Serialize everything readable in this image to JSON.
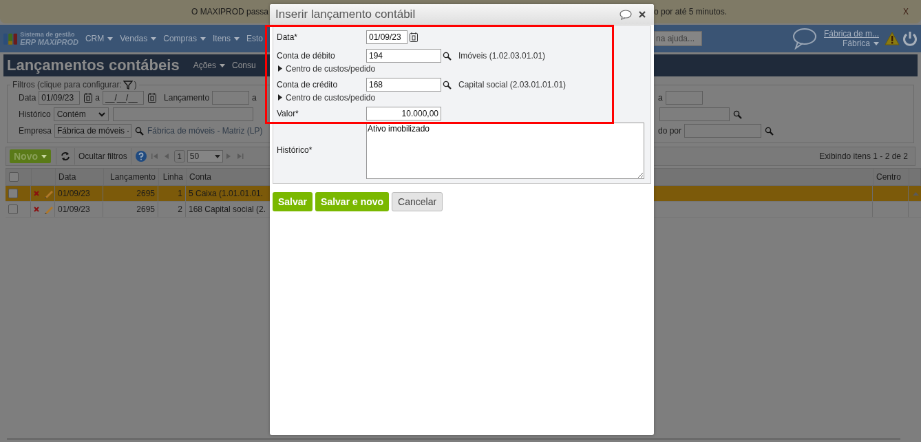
{
  "banner": {
    "text_left": "O MAXIPROD passa",
    "text_right": "o por até 5 minutos.",
    "close": "X"
  },
  "nav": {
    "brand_line1": "Sistema de gestão",
    "brand_line2": "ERP MAXIPROD",
    "menus": [
      {
        "label": "CRM",
        "dropdown": true
      },
      {
        "label": "Vendas",
        "dropdown": true
      },
      {
        "label": "Compras",
        "dropdown": true
      },
      {
        "label": "Itens",
        "dropdown": true
      },
      {
        "label": "Esto",
        "dropdown": false
      }
    ],
    "search": {
      "placeholder": "na ajuda..."
    },
    "company_link": "Fábrica de m...",
    "profile": "Fábrica"
  },
  "page_title": "Lançamentos contábeis",
  "page_menus": [
    {
      "label": "Ações",
      "dropdown": true
    },
    {
      "label": "Consu",
      "dropdown": false
    }
  ],
  "filters": {
    "legend": "Filtros (clique para configurar:",
    "legend_end": ")",
    "date": {
      "label": "Data",
      "from": "01/09/23",
      "sep": "a",
      "to": "__/__/__"
    },
    "entry": {
      "label": "Lançamento",
      "sep": "a"
    },
    "history": {
      "label": "Histórico",
      "mode": "Contém"
    },
    "company": {
      "label": "Empresa",
      "value": "Fábrica de móveis -",
      "description": "Fábrica de móveis - Matriz (LP)"
    },
    "right_sep": "a",
    "right_label": "do por"
  },
  "toolbar": {
    "new_button": "Novo",
    "hide_filters": "Ocultar filtros",
    "page": "1",
    "page_size": "50",
    "summary": "Exibindo itens 1 - 2 de 2"
  },
  "table": {
    "select_all": {
      "checked": false
    },
    "columns": [
      "Data",
      "Lançamento",
      "Linha",
      "Conta",
      "Centro"
    ],
    "rows": [
      {
        "selected": true,
        "checked": false,
        "date": "01/09/23",
        "entry": "2695",
        "line": "1",
        "account": "5 Caixa (1.01.01.01."
      },
      {
        "selected": false,
        "checked": false,
        "date": "01/09/23",
        "entry": "2695",
        "line": "2",
        "account": "168 Capital social (2."
      }
    ]
  },
  "dialog": {
    "title": "Inserir lançamento contábil",
    "marked_section": {
      "kind": "frame",
      "fields": [
        {
          "kind": "date",
          "label": "Data*",
          "value": "01/09/23"
        },
        {
          "kind": "account",
          "label": "Conta de débito",
          "value": "194",
          "description": "Imóveis (1.02.03.01.01)"
        },
        {
          "kind": "expander",
          "text": "Centro de custos/pedido",
          "expanded": false
        },
        {
          "kind": "account",
          "label": "Conta de crédito",
          "value": "168",
          "description": "Capital social (2.03.01.01.01)"
        },
        {
          "kind": "expander",
          "text": "Centro de custos/pedido",
          "expanded": false
        },
        {
          "kind": "amount",
          "label": "Valor*",
          "value": "10.000,00"
        }
      ]
    },
    "fields": [
      {
        "kind": "textarea",
        "label": "Histórico*",
        "value": "Ativo imobilizado"
      }
    ],
    "buttons": [
      {
        "label": "Salvar",
        "kind": "primary"
      },
      {
        "label": "Salvar e novo",
        "kind": "primary"
      },
      {
        "label": "Cancelar",
        "kind": "secondary"
      }
    ]
  }
}
